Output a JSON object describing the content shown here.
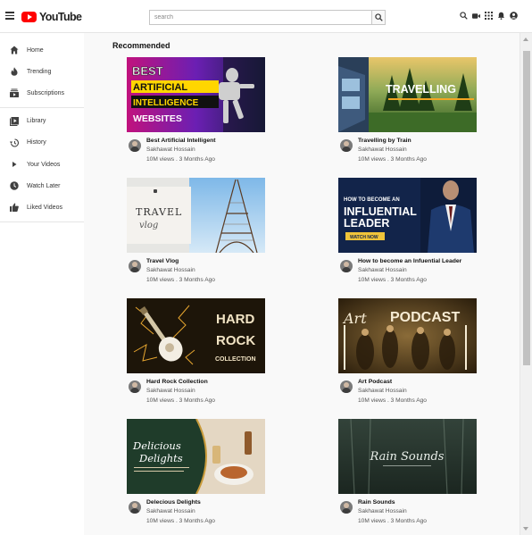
{
  "header": {
    "logo_text": "YouTube",
    "search_placeholder": "search"
  },
  "sidebar": {
    "items": [
      {
        "label": "Home",
        "icon": "home-icon"
      },
      {
        "label": "Trending",
        "icon": "flame-icon"
      },
      {
        "label": "Subscriptions",
        "icon": "subscriptions-icon"
      },
      {
        "label": "Library",
        "icon": "library-icon"
      },
      {
        "label": "History",
        "icon": "history-icon"
      },
      {
        "label": "Your Videos",
        "icon": "play-icon"
      },
      {
        "label": "Watch Later",
        "icon": "clock-icon"
      },
      {
        "label": "Liked Videos",
        "icon": "thumbs-up-icon"
      }
    ]
  },
  "main": {
    "section_title": "Recommended",
    "videos": [
      {
        "title": "Best Artificial Intelligent",
        "channel": "Sakhawat Hossain",
        "stats": "10M views . 3 Months Ago",
        "thumb_text": [
          "BEST",
          "ARTIFICIAL",
          "INTELLIGENCE",
          "WEBSITES"
        ]
      },
      {
        "title": "Travelling by Train",
        "channel": "Sakhawat Hossain",
        "stats": "10M views . 3 Months Ago",
        "thumb_text": [
          "TRAVELLING"
        ]
      },
      {
        "title": "Travel Vlog",
        "channel": "Sakhawat Hossain",
        "stats": "10M views . 3 Months Ago",
        "thumb_text": [
          "TRAVEL",
          "vlog"
        ]
      },
      {
        "title": "How to become an Infuential Leader",
        "channel": "Sakhawat Hossain",
        "stats": "10M views . 3 Months Ago",
        "thumb_text": [
          "HOW TO BECOME AN",
          "INFLUENTIAL",
          "LEADER",
          "WATCH NOW"
        ]
      },
      {
        "title": "Hard Rock Collection",
        "channel": "Sakhawat Hossain",
        "stats": "10M views . 3 Months Ago",
        "thumb_text": [
          "HARD",
          "ROCK",
          "COLLECTION"
        ]
      },
      {
        "title": "Art Podcast",
        "channel": "Sakhawat Hossain",
        "stats": "10M views . 3 Months Ago",
        "thumb_text": [
          "Art",
          "PODCAST"
        ]
      },
      {
        "title": "Delecious Delights",
        "channel": "Sakhawat Hossain",
        "stats": "10M views . 3 Months Ago",
        "thumb_text": [
          "Delicious",
          "Delights"
        ]
      },
      {
        "title": "Rain Sounds",
        "channel": "Sakhawat Hossain",
        "stats": "10M views . 3 Months Ago",
        "thumb_text": [
          "Rain Sounds"
        ]
      }
    ]
  },
  "colors": {
    "brand_red": "#ff0000",
    "page_bg": "#f9f9f9"
  }
}
